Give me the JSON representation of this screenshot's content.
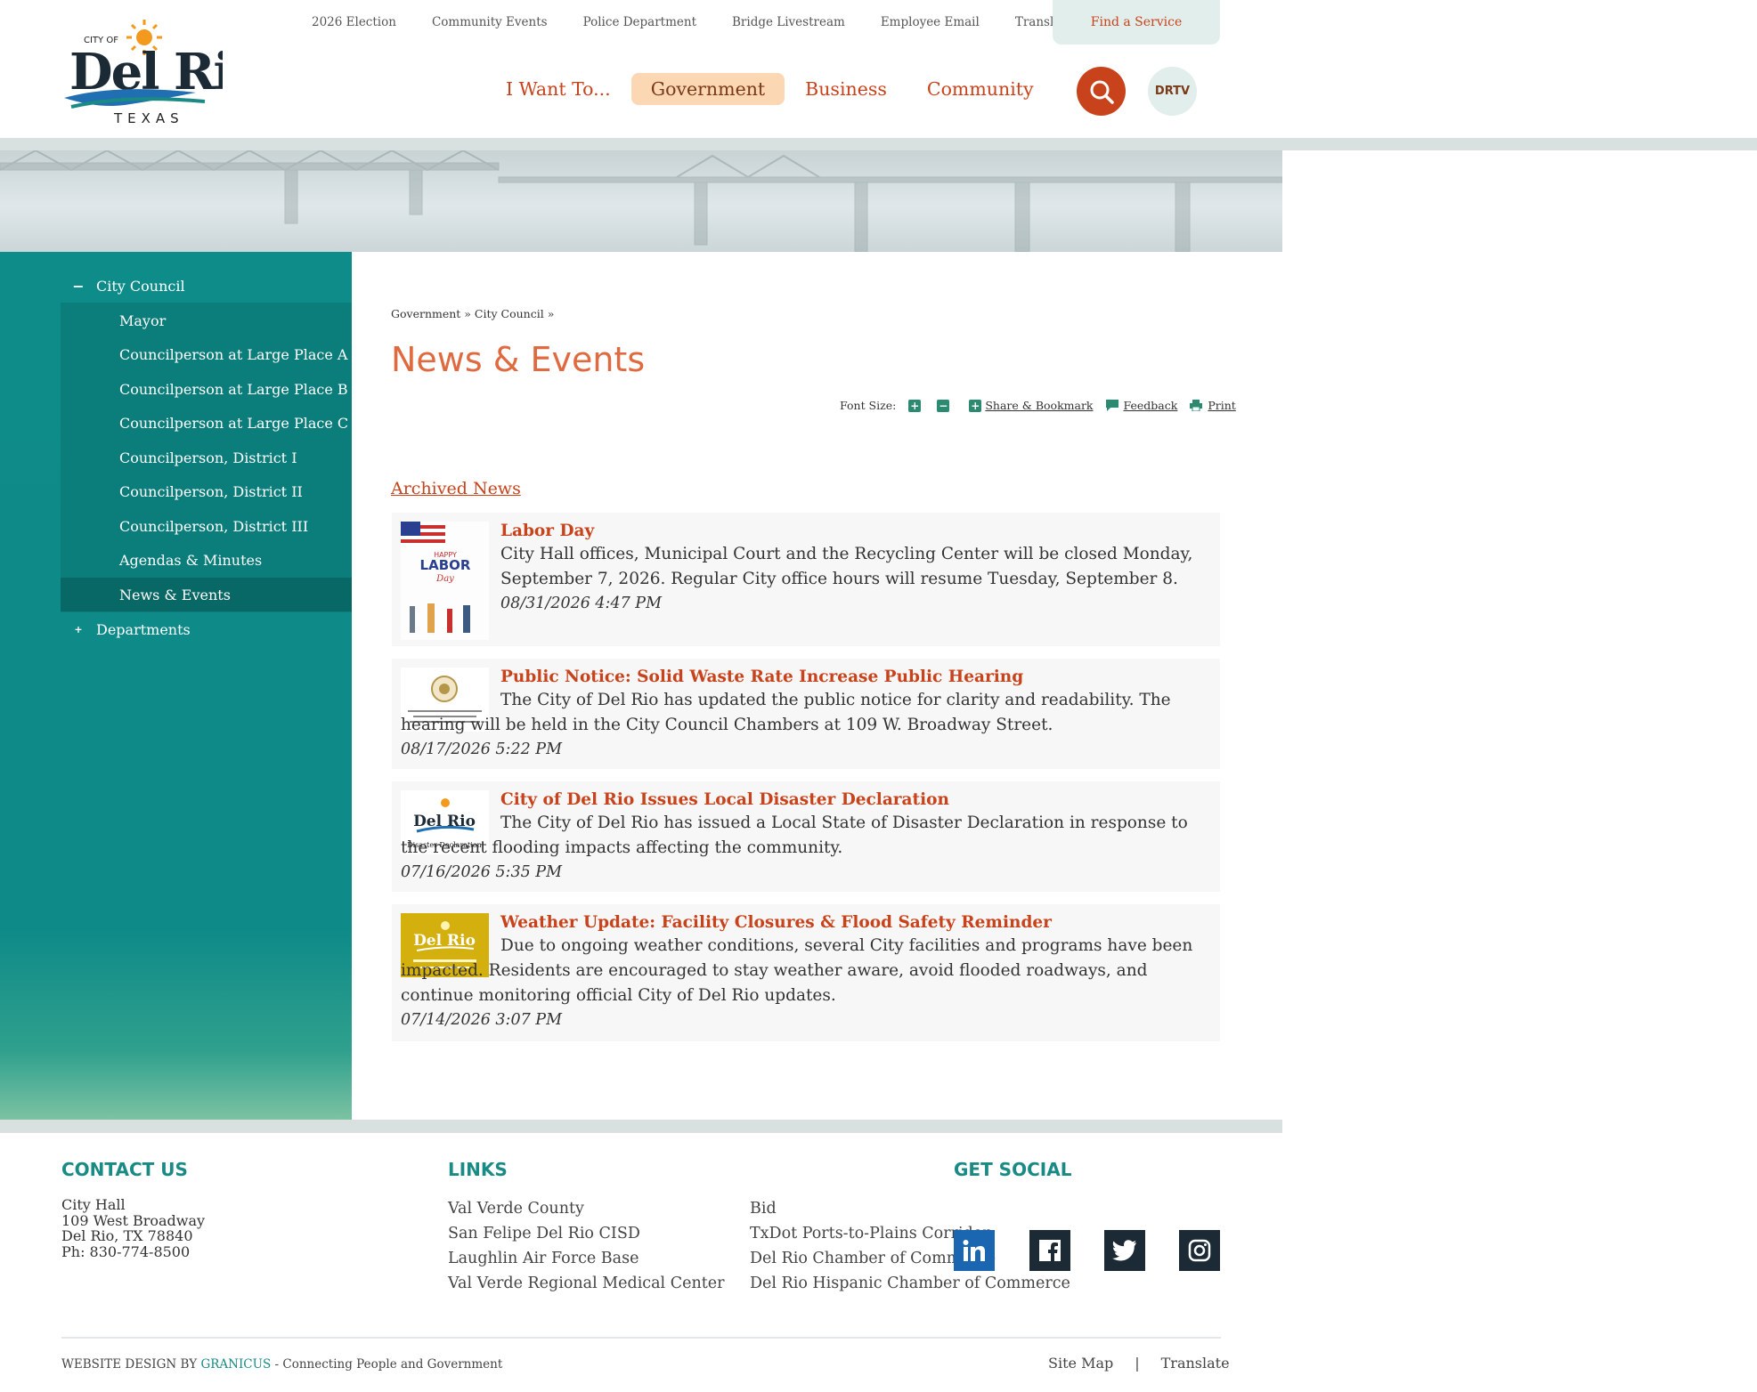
{
  "header": {
    "logo": {
      "top_text": "CITY OF",
      "name": "Del Rio",
      "state": "TEXAS"
    },
    "utility_nav": [
      "2026 Election",
      "Community Events",
      "Police Department",
      "Bridge Livestream",
      "Employee Email",
      "Translate"
    ],
    "find_service": "Find a Service",
    "main_nav": [
      {
        "label": "I Want To..."
      },
      {
        "label": "Government",
        "active": true
      },
      {
        "label": "Business"
      },
      {
        "label": "Community"
      }
    ],
    "search_icon": "search-icon",
    "drtv_label": "DRTV"
  },
  "sidebar": {
    "parent": {
      "toggle": "−",
      "label": "City Council"
    },
    "items": [
      "Mayor",
      "Councilperson at Large Place A",
      "Councilperson at Large Place B",
      "Councilperson at Large Place C",
      "Councilperson, District I",
      "Councilperson, District II",
      "Councilperson, District III",
      "Agendas & Minutes",
      "News & Events"
    ],
    "active_item": "News & Events",
    "departments": {
      "toggle": "+",
      "label": "Departments"
    }
  },
  "main": {
    "breadcrumb": "Government » City Council »",
    "title": "News & Events",
    "tools": {
      "font_size_label": "Font Size:",
      "increase": "+",
      "decrease": "−",
      "share": "Share & Bookmark",
      "feedback": "Feedback",
      "print": "Print"
    },
    "archived_label": "Archived News",
    "news": [
      {
        "title": "Labor Day",
        "body": "City Hall offices, Municipal Court and the Recycling Center will be closed Monday, September 7, 2026. Regular City office hours will resume Tuesday, September 8.",
        "date": "08/31/2026 4:47 PM",
        "thumb_text": [
          "HAPPY",
          "LABOR",
          "Day"
        ]
      },
      {
        "title": "Public Notice: Solid Waste Rate Increase Public Hearing",
        "body": "The City of Del Rio has updated the public notice for clarity and readability. The hearing will be held in the City Council Chambers at 109 W. Broadway Street.",
        "date": "08/17/2026 5:22 PM"
      },
      {
        "title": "City of Del Rio Issues Local Disaster Declaration",
        "body": "The City of Del Rio has issued a Local State of Disaster Declaration in response to the recent flooding impacts affecting the community.",
        "date": "07/16/2026 5:35 PM",
        "thumb_text": [
          "Del Rio",
          "Disaster Declaration"
        ]
      },
      {
        "title": "Weather Update: Facility Closures & Flood Safety Reminder",
        "body": "Due to ongoing weather conditions, several City facilities and programs have been impacted. Residents are encouraged to stay weather aware, avoid flooded roadways, and continue monitoring official City of Del Rio updates.",
        "date": "07/14/2026 3:07 PM",
        "thumb_text": [
          "Del Rio"
        ]
      }
    ]
  },
  "footer": {
    "contact_heading": "CONTACT US",
    "contact": [
      "City Hall",
      "109 West Broadway",
      "Del Rio, TX 78840",
      "Ph: 830-774-8500"
    ],
    "links_heading": "LINKS",
    "links_col1": [
      "Val Verde County",
      "San Felipe Del Rio CISD",
      "Laughlin Air Force Base",
      "Val Verde Regional Medical Center"
    ],
    "links_col2": [
      "Bid",
      "TxDot Ports-to-Plains Corridor",
      "Del Rio Chamber of Commerce",
      "Del Rio Hispanic Chamber of Commerce"
    ],
    "social_heading": "GET SOCIAL",
    "social_icons": [
      "linkedin-icon",
      "facebook-icon",
      "twitter-icon",
      "instagram-icon"
    ],
    "credit_prefix": "WEBSITE DESIGN BY",
    "credit_brand": "GRANICUS",
    "credit_suffix": "- Connecting People and Government",
    "site_map": "Site Map",
    "separator": "|",
    "translate": "Translate"
  },
  "colors": {
    "accent": "#c8431b",
    "teal": "#0e8c8a",
    "title_orange": "#e06a3f",
    "active_nav_bg": "#fbd7b4"
  }
}
